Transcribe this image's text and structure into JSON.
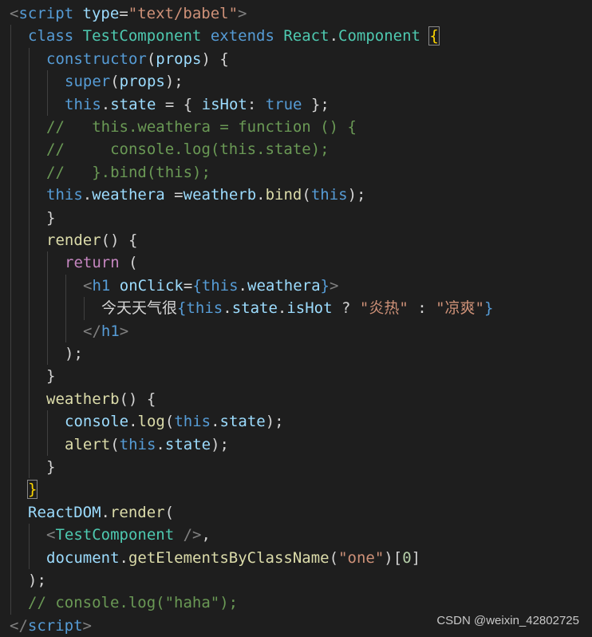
{
  "editor": {
    "lines": [
      {
        "indent": 0,
        "tokens": [
          [
            "<",
            "tag"
          ],
          [
            "script",
            "tagname"
          ],
          [
            " ",
            "text"
          ],
          [
            "type",
            "attr"
          ],
          [
            "=",
            "text"
          ],
          [
            "\"text/babel\"",
            "str"
          ],
          [
            ">",
            "tag"
          ]
        ]
      },
      {
        "indent": 1,
        "tokens": [
          [
            "class",
            "kw"
          ],
          [
            " ",
            "text"
          ],
          [
            "TestComponent",
            "class"
          ],
          [
            " ",
            "text"
          ],
          [
            "extends",
            "kw"
          ],
          [
            " ",
            "text"
          ],
          [
            "React",
            "class"
          ],
          [
            ".",
            "text"
          ],
          [
            "Component",
            "class"
          ],
          [
            " ",
            "text"
          ],
          [
            "{",
            "brace-match"
          ]
        ]
      },
      {
        "indent": 2,
        "tokens": [
          [
            "constructor",
            "kw"
          ],
          [
            "(",
            "text"
          ],
          [
            "props",
            "var"
          ],
          [
            ") {",
            "text"
          ]
        ]
      },
      {
        "indent": 3,
        "tokens": [
          [
            "super",
            "kw"
          ],
          [
            "(",
            "text"
          ],
          [
            "props",
            "var"
          ],
          [
            ");",
            "text"
          ]
        ]
      },
      {
        "indent": 3,
        "tokens": [
          [
            "this",
            "kw"
          ],
          [
            ".",
            "text"
          ],
          [
            "state",
            "var"
          ],
          [
            " = { ",
            "text"
          ],
          [
            "isHot",
            "var"
          ],
          [
            ": ",
            "text"
          ],
          [
            "true",
            "kw"
          ],
          [
            " };",
            "text"
          ]
        ]
      },
      {
        "indent": 2,
        "tokens": [
          [
            "//   this.weathera = function () {",
            "comment"
          ]
        ]
      },
      {
        "indent": 2,
        "tokens": [
          [
            "//     console.log(this.state);",
            "comment"
          ]
        ]
      },
      {
        "indent": 2,
        "tokens": [
          [
            "//   }.bind(this);",
            "comment"
          ]
        ]
      },
      {
        "indent": 2,
        "tokens": [
          [
            "this",
            "kw"
          ],
          [
            ".",
            "text"
          ],
          [
            "weathera",
            "var"
          ],
          [
            " =",
            "text"
          ],
          [
            "weatherb",
            "var"
          ],
          [
            ".",
            "text"
          ],
          [
            "bind",
            "func"
          ],
          [
            "(",
            "text"
          ],
          [
            "this",
            "kw"
          ],
          [
            ");",
            "text"
          ]
        ]
      },
      {
        "indent": 2,
        "tokens": [
          [
            "}",
            "text"
          ]
        ]
      },
      {
        "indent": 2,
        "tokens": [
          [
            "render",
            "func"
          ],
          [
            "() {",
            "text"
          ]
        ]
      },
      {
        "indent": 3,
        "tokens": [
          [
            "return",
            "ctrl"
          ],
          [
            " (",
            "text"
          ]
        ]
      },
      {
        "indent": 4,
        "tokens": [
          [
            "<",
            "tag"
          ],
          [
            "h1",
            "tagname"
          ],
          [
            " ",
            "text"
          ],
          [
            "onClick",
            "attr"
          ],
          [
            "=",
            "text"
          ],
          [
            "{",
            "kw"
          ],
          [
            "this",
            "kw"
          ],
          [
            ".",
            "text"
          ],
          [
            "weathera",
            "var"
          ],
          [
            "}",
            "kw"
          ],
          [
            ">",
            "tag"
          ]
        ]
      },
      {
        "indent": 5,
        "tokens": [
          [
            "今天天气很",
            "text"
          ],
          [
            "{",
            "kw"
          ],
          [
            "this",
            "kw"
          ],
          [
            ".",
            "text"
          ],
          [
            "state",
            "var"
          ],
          [
            ".",
            "text"
          ],
          [
            "isHot",
            "var"
          ],
          [
            " ? ",
            "text"
          ],
          [
            "\"炎热\"",
            "str"
          ],
          [
            " : ",
            "text"
          ],
          [
            "\"凉爽\"",
            "str"
          ],
          [
            "}",
            "kw"
          ]
        ]
      },
      {
        "indent": 4,
        "tokens": [
          [
            "</",
            "tag"
          ],
          [
            "h1",
            "tagname"
          ],
          [
            ">",
            "tag"
          ]
        ]
      },
      {
        "indent": 3,
        "tokens": [
          [
            ");",
            "text"
          ]
        ]
      },
      {
        "indent": 2,
        "tokens": [
          [
            "}",
            "text"
          ]
        ]
      },
      {
        "indent": 2,
        "tokens": [
          [
            "weatherb",
            "func"
          ],
          [
            "() {",
            "text"
          ]
        ]
      },
      {
        "indent": 3,
        "tokens": [
          [
            "console",
            "var"
          ],
          [
            ".",
            "text"
          ],
          [
            "log",
            "func"
          ],
          [
            "(",
            "text"
          ],
          [
            "this",
            "kw"
          ],
          [
            ".",
            "text"
          ],
          [
            "state",
            "var"
          ],
          [
            ");",
            "text"
          ]
        ]
      },
      {
        "indent": 3,
        "tokens": [
          [
            "alert",
            "func"
          ],
          [
            "(",
            "text"
          ],
          [
            "this",
            "kw"
          ],
          [
            ".",
            "text"
          ],
          [
            "state",
            "var"
          ],
          [
            ");",
            "text"
          ]
        ]
      },
      {
        "indent": 2,
        "tokens": [
          [
            "}",
            "text"
          ]
        ]
      },
      {
        "indent": 1,
        "tokens": [
          [
            "}",
            "brace-match"
          ]
        ]
      },
      {
        "indent": 1,
        "tokens": [
          [
            "ReactDOM",
            "var"
          ],
          [
            ".",
            "text"
          ],
          [
            "render",
            "func"
          ],
          [
            "(",
            "text"
          ]
        ]
      },
      {
        "indent": 2,
        "tokens": [
          [
            "<",
            "tag"
          ],
          [
            "TestComponent",
            "class"
          ],
          [
            " />",
            "tag"
          ],
          [
            ",",
            "text"
          ]
        ]
      },
      {
        "indent": 2,
        "tokens": [
          [
            "document",
            "var"
          ],
          [
            ".",
            "text"
          ],
          [
            "getElementsByClassName",
            "func"
          ],
          [
            "(",
            "text"
          ],
          [
            "\"one\"",
            "str"
          ],
          [
            ")[",
            "text"
          ],
          [
            "0",
            "num"
          ],
          [
            "]",
            "text"
          ]
        ]
      },
      {
        "indent": 1,
        "tokens": [
          [
            ");",
            "text"
          ]
        ]
      },
      {
        "indent": 1,
        "tokens": [
          [
            "// console.log(\"haha\");",
            "comment"
          ]
        ]
      },
      {
        "indent": 0,
        "tokens": [
          [
            "</",
            "tag"
          ],
          [
            "script",
            "tagname"
          ],
          [
            ">",
            "tag"
          ]
        ]
      }
    ]
  },
  "watermark": {
    "text": "CSDN @weixin_42802725"
  },
  "colors": {
    "background": "#1e1e1e",
    "text": "#d4d4d4",
    "keyword": "#569cd6",
    "class": "#4ec9b0",
    "function": "#dcdcaa",
    "variable": "#9cdcfe",
    "string": "#ce9178",
    "comment": "#6a9955",
    "number": "#b5cea8",
    "control": "#c586c0",
    "tag-bracket": "#808080",
    "brace-match": "#ffd700"
  }
}
